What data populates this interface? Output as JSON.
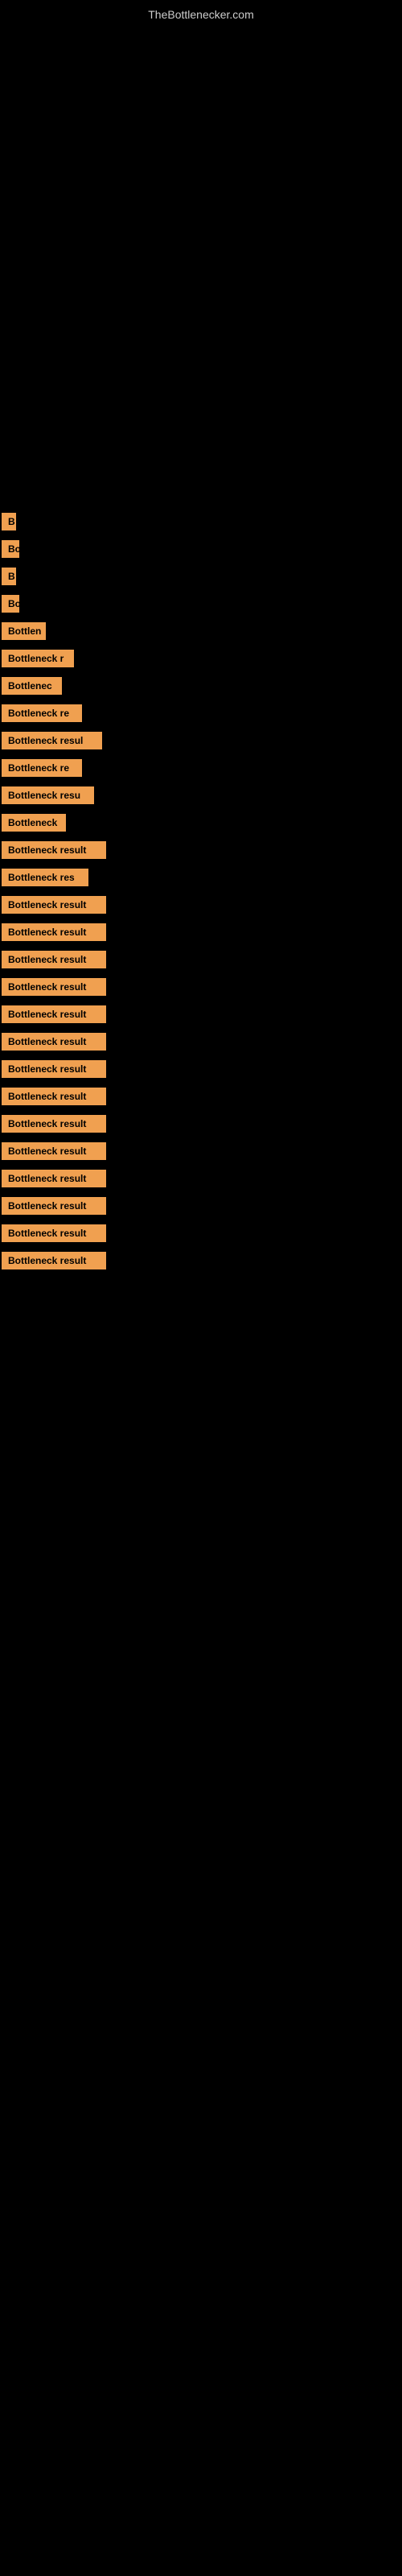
{
  "site": {
    "title": "TheBottlenecker.com"
  },
  "results": [
    {
      "label": "",
      "width": 5,
      "marginTop": 550
    },
    {
      "label": "B",
      "width": 18,
      "marginTop": 620
    },
    {
      "label": "Bo",
      "width": 22,
      "marginTop": 650
    },
    {
      "label": "B",
      "width": 18,
      "marginTop": 680
    },
    {
      "label": "Bo",
      "width": 22,
      "marginTop": 710
    },
    {
      "label": "Bottlen",
      "width": 55,
      "marginTop": 740
    },
    {
      "label": "Bottleneck r",
      "width": 90,
      "marginTop": 770
    },
    {
      "label": "Bottlenec",
      "width": 75,
      "marginTop": 800
    },
    {
      "label": "Bottleneck re",
      "width": 100,
      "marginTop": 830
    },
    {
      "label": "Bottleneck resul",
      "width": 125,
      "marginTop": 860
    },
    {
      "label": "Bottleneck re",
      "width": 100,
      "marginTop": 890
    },
    {
      "label": "Bottleneck resu",
      "width": 115,
      "marginTop": 920
    },
    {
      "label": "Bottleneck",
      "width": 80,
      "marginTop": 950
    },
    {
      "label": "Bottleneck result",
      "width": 130,
      "marginTop": 980
    },
    {
      "label": "Bottleneck res",
      "width": 108,
      "marginTop": 1010
    },
    {
      "label": "Bottleneck result",
      "width": 130,
      "marginTop": 1040
    },
    {
      "label": "Bottleneck result",
      "width": 130,
      "marginTop": 1070
    },
    {
      "label": "Bottleneck result",
      "width": 130,
      "marginTop": 1100
    },
    {
      "label": "Bottleneck result",
      "width": 130,
      "marginTop": 1130
    },
    {
      "label": "Bottleneck result",
      "width": 130,
      "marginTop": 1160
    },
    {
      "label": "Bottleneck result",
      "width": 130,
      "marginTop": 1190
    },
    {
      "label": "Bottleneck result",
      "width": 130,
      "marginTop": 1220
    },
    {
      "label": "Bottleneck result",
      "width": 130,
      "marginTop": 1250
    },
    {
      "label": "Bottleneck result",
      "width": 130,
      "marginTop": 1280
    },
    {
      "label": "Bottleneck result",
      "width": 130,
      "marginTop": 1310
    },
    {
      "label": "Bottleneck result",
      "width": 130,
      "marginTop": 1340
    },
    {
      "label": "Bottleneck result",
      "width": 130,
      "marginTop": 1370
    },
    {
      "label": "Bottleneck result",
      "width": 130,
      "marginTop": 1400
    },
    {
      "label": "Bottleneck result",
      "width": 130,
      "marginTop": 1430
    }
  ]
}
